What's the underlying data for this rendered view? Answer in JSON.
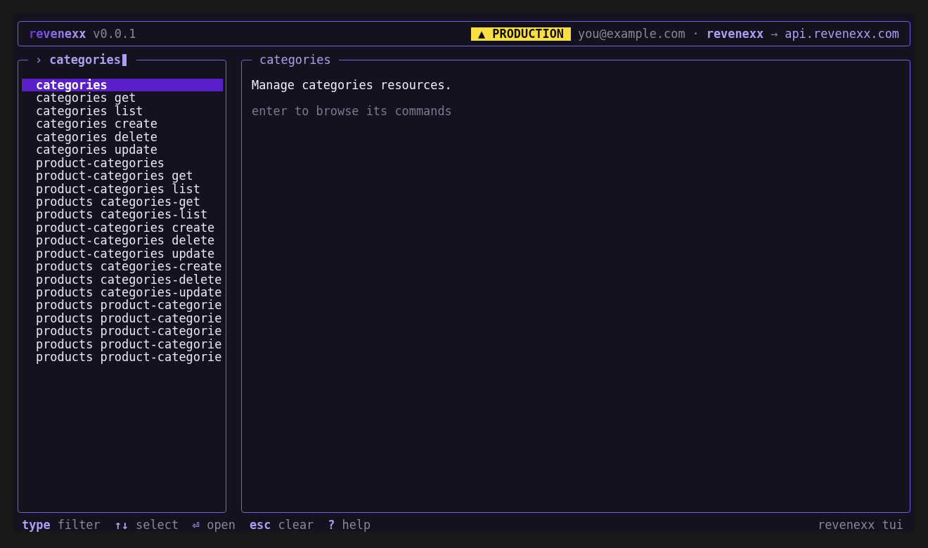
{
  "header": {
    "app_name": "revenexx",
    "version": "v0.0.1",
    "environment_badge": "▲ PRODUCTION",
    "user": "you@example.com",
    "separator": "·",
    "workspace": "revenexx",
    "arrow": "→",
    "endpoint": "api.revenexx.com"
  },
  "filter": {
    "prompt": "›",
    "value": "categories"
  },
  "commands": [
    {
      "label": "categories",
      "selected": true
    },
    {
      "label": "categories get",
      "selected": false
    },
    {
      "label": "categories list",
      "selected": false
    },
    {
      "label": "categories create",
      "selected": false
    },
    {
      "label": "categories delete",
      "selected": false
    },
    {
      "label": "categories update",
      "selected": false
    },
    {
      "label": "product-categories",
      "selected": false
    },
    {
      "label": "product-categories get",
      "selected": false
    },
    {
      "label": "product-categories list",
      "selected": false
    },
    {
      "label": "products categories-get",
      "selected": false
    },
    {
      "label": "products categories-list",
      "selected": false
    },
    {
      "label": "product-categories create",
      "selected": false
    },
    {
      "label": "product-categories delete",
      "selected": false
    },
    {
      "label": "product-categories update",
      "selected": false
    },
    {
      "label": "products categories-create",
      "selected": false
    },
    {
      "label": "products categories-delete",
      "selected": false
    },
    {
      "label": "products categories-update",
      "selected": false
    },
    {
      "label": "products product-categorie",
      "selected": false
    },
    {
      "label": "products product-categorie",
      "selected": false
    },
    {
      "label": "products product-categorie",
      "selected": false
    },
    {
      "label": "products product-categorie",
      "selected": false
    },
    {
      "label": "products product-categorie",
      "selected": false
    }
  ],
  "detail": {
    "title": "categories",
    "description": "Manage categories resources.",
    "hint": "enter to browse its commands"
  },
  "footer": {
    "shortcuts": [
      {
        "key": "type",
        "action": "filter"
      },
      {
        "key": "↑↓",
        "action": "select"
      },
      {
        "key": "⏎",
        "action": "open"
      },
      {
        "key": "esc",
        "action": "clear"
      },
      {
        "key": "?",
        "action": "help"
      }
    ],
    "brand": "revenexx tui"
  }
}
